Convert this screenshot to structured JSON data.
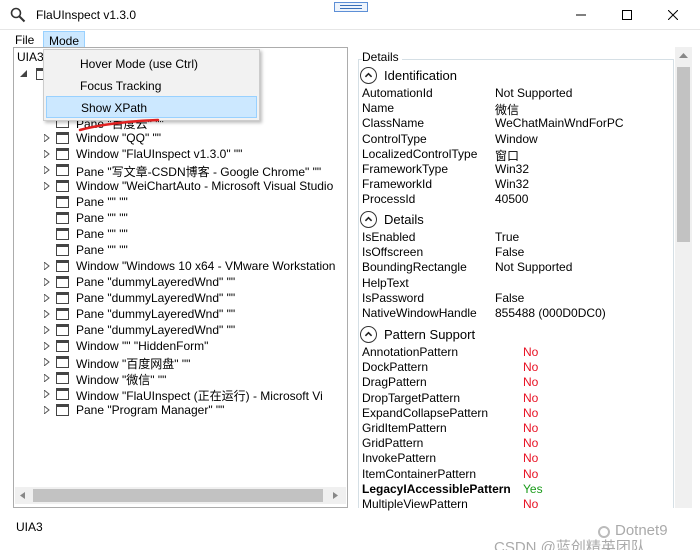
{
  "window": {
    "title": "FlaUInspect v1.3.0"
  },
  "menu": {
    "file": "File",
    "mode": "Mode"
  },
  "mode_menu": {
    "items": [
      "Hover Mode (use Ctrl)",
      "Focus Tracking",
      "Show XPath"
    ]
  },
  "left": {
    "tab": "UIA3",
    "tree": [
      {
        "label": "Pane \"百度云\" \"\"",
        "caret": false
      },
      {
        "label": "Window \"QQ\" \"\"",
        "caret": true
      },
      {
        "label": "Window \"FlaUInspect v1.3.0\" \"\"",
        "caret": true
      },
      {
        "label": "Pane \"写文章-CSDN博客 - Google Chrome\" \"\"",
        "caret": true
      },
      {
        "label": "Window \"WeiChartAuto - Microsoft Visual Studio",
        "caret": true
      },
      {
        "label": "Pane \"\" \"\"",
        "caret": false
      },
      {
        "label": "Pane \"\" \"\"",
        "caret": false
      },
      {
        "label": "Pane \"\" \"\"",
        "caret": false
      },
      {
        "label": "Pane \"\" \"\"",
        "caret": false
      },
      {
        "label": "Window \"Windows 10 x64 - VMware Workstation",
        "caret": true
      },
      {
        "label": "Pane \"dummyLayeredWnd\" \"\"",
        "caret": true
      },
      {
        "label": "Pane \"dummyLayeredWnd\" \"\"",
        "caret": true
      },
      {
        "label": "Pane \"dummyLayeredWnd\" \"\"",
        "caret": true
      },
      {
        "label": "Pane \"dummyLayeredWnd\" \"\"",
        "caret": true
      },
      {
        "label": "Window \"\" \"HiddenForm\"",
        "caret": true
      },
      {
        "label": "Window \"百度网盘\" \"\"",
        "caret": true
      },
      {
        "label": "Window \"微信\" \"\"",
        "caret": true
      },
      {
        "label": "Window \"FlaUInspect (正在运行) - Microsoft Vi",
        "caret": true
      },
      {
        "label": "Pane \"Program Manager\" \"\"",
        "caret": true
      }
    ]
  },
  "details": {
    "header": "Details",
    "identification": {
      "title": "Identification",
      "rows": [
        {
          "key": "AutomationId",
          "value": "Not Supported"
        },
        {
          "key": "Name",
          "value": "微信"
        },
        {
          "key": "ClassName",
          "value": "WeChatMainWndForPC"
        },
        {
          "key": "ControlType",
          "value": "Window"
        },
        {
          "key": "LocalizedControlType",
          "value": "窗口"
        },
        {
          "key": "FrameworkType",
          "value": "Win32"
        },
        {
          "key": "FrameworkId",
          "value": "Win32"
        },
        {
          "key": "ProcessId",
          "value": "40500"
        }
      ]
    },
    "details_section": {
      "title": "Details",
      "rows": [
        {
          "key": "IsEnabled",
          "value": "True"
        },
        {
          "key": "IsOffscreen",
          "value": "False"
        },
        {
          "key": "BoundingRectangle",
          "value": "Not Supported"
        },
        {
          "key": "HelpText",
          "value": ""
        },
        {
          "key": "IsPassword",
          "value": "False"
        },
        {
          "key": "NativeWindowHandle",
          "value": "855488 (000D0DC0)"
        }
      ]
    },
    "patterns": {
      "title": "Pattern Support",
      "rows": [
        {
          "key": "AnnotationPattern",
          "value": "No"
        },
        {
          "key": "DockPattern",
          "value": "No"
        },
        {
          "key": "DragPattern",
          "value": "No"
        },
        {
          "key": "DropTargetPattern",
          "value": "No"
        },
        {
          "key": "ExpandCollapsePattern",
          "value": "No"
        },
        {
          "key": "GridItemPattern",
          "value": "No"
        },
        {
          "key": "GridPattern",
          "value": "No"
        },
        {
          "key": "InvokePattern",
          "value": "No"
        },
        {
          "key": "ItemContainerPattern",
          "value": "No"
        },
        {
          "key": "LegacyIAccessiblePattern",
          "value": "Yes"
        },
        {
          "key": "MultipleViewPattern",
          "value": "No"
        }
      ]
    }
  },
  "status": {
    "text": "UIA3"
  },
  "watermark": {
    "text": "CSDN @蓝创精英团队",
    "brand": "Dotnet9"
  },
  "colors": {
    "no": "#e81123",
    "yes": "#1a9b1a",
    "highlight": "#cce8ff",
    "underline": "#e02020"
  }
}
